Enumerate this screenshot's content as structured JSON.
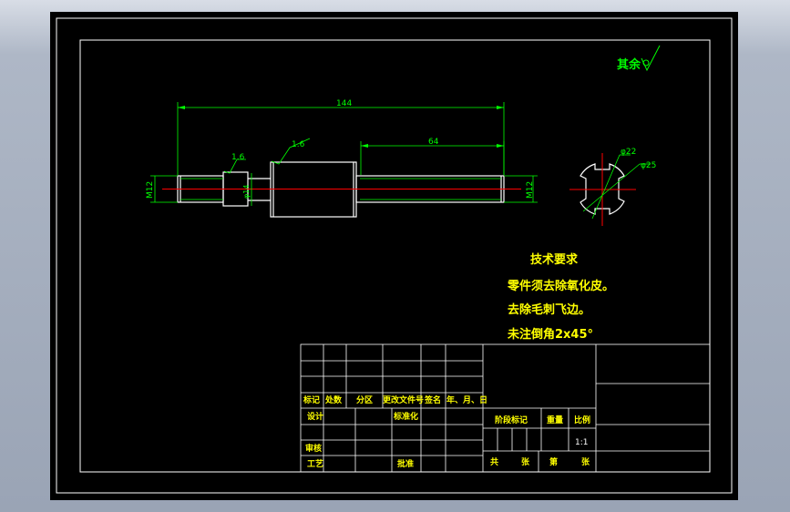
{
  "drawing": {
    "surface_mark": "其余",
    "dim_overall": "144",
    "dim_thread_length": "64",
    "roughness_a": "1.6",
    "roughness_b": "1.6",
    "dia_left": "M12",
    "dia_neck": "φ14",
    "dia_right": "M12",
    "dia_inner": "φ22",
    "dia_outer": "φ25"
  },
  "notes": {
    "title": "技术要求",
    "lines": [
      "零件须去除氧化皮。",
      "去除毛刺飞边。",
      "未注倒角2x45°"
    ]
  },
  "title_block": {
    "row_labels": [
      "标记",
      "处数",
      "分区",
      "更改文件号",
      "签名",
      "年、月、日"
    ],
    "design": "设计",
    "standardize": "标准化",
    "review": "审核",
    "process": "工艺",
    "approve": "批准",
    "stage_mark": "阶段标记",
    "weight": "重量",
    "scale_label": "比例",
    "scale_value": "1:1",
    "total": "共",
    "sheets": "张",
    "sheet_no": "第",
    "sheet": "张"
  },
  "colors": {
    "background": "#000000",
    "line": "#ffffff",
    "dimension": "#00ff00",
    "center": "#ff0000",
    "text": "#ffff00"
  }
}
